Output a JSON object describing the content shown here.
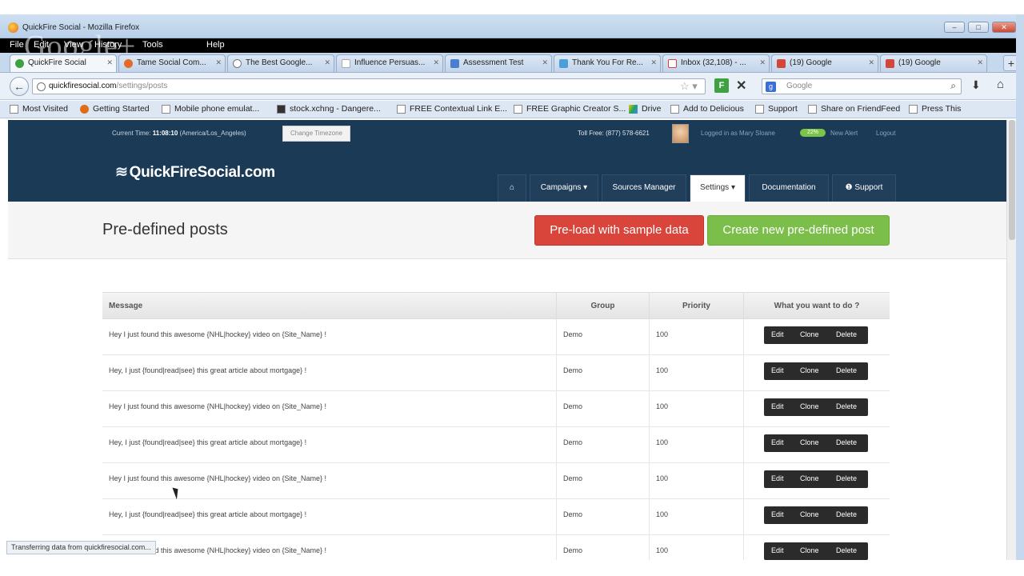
{
  "window": {
    "title": "QuickFire Social - Mozilla Firefox"
  },
  "menubar": {
    "items": [
      "File",
      "Edit",
      "View",
      "History",
      "Tools",
      "Help"
    ],
    "overlay": "Google+"
  },
  "tabs": [
    {
      "label": "QuickFire Social",
      "color": "#3fa142"
    },
    {
      "label": "Tame Social Com...",
      "color": "#e26b2b"
    },
    {
      "label": "The Best Google...",
      "color": "#777777"
    },
    {
      "label": "Influence Persuas...",
      "color": "#bbbbbb"
    },
    {
      "label": "Assessment Test",
      "color": "#4a7fd0"
    },
    {
      "label": "Thank You For Re...",
      "color": "#4a9fd8"
    },
    {
      "label": "Inbox (32,108) - ...",
      "color": "#d4453a"
    },
    {
      "label": "(19) Google",
      "color": "#d4453a"
    },
    {
      "label": "(19) Google",
      "color": "#d4453a"
    }
  ],
  "navbar": {
    "url_host": "quickfiresocial.com",
    "url_path": "/settings/posts",
    "search_placeholder": "Google",
    "f_label": "F",
    "g_label": "g"
  },
  "bookmarks": [
    "Most Visited",
    "Getting Started",
    "Mobile phone emulat...",
    "stock.xchng - Dangere...",
    "FREE Contextual Link E...",
    "FREE Graphic Creator S...",
    "Drive",
    "Add to Delicious",
    "Support",
    "Share on FriendFeed",
    "Press This"
  ],
  "topstrip": {
    "current_time_label": "Current Time:",
    "current_time_value": "11:08:10",
    "timezone": "(America/Los_Angeles)",
    "change_timezone": "Change Timezone",
    "toll_free": "Toll Free: (877) 578-6621",
    "logged_in": "Logged in as Mary Sloane",
    "badge": "22%",
    "new_alert": "New Alert",
    "logout": "Logout"
  },
  "header": {
    "logo": "QuickFireSocial.com",
    "nav": [
      {
        "label": "⌂"
      },
      {
        "label": "Campaigns ▾"
      },
      {
        "label": "Sources Manager"
      },
      {
        "label": "Settings ▾"
      },
      {
        "label": "Documentation"
      },
      {
        "label": "❶ Support"
      }
    ]
  },
  "subheader": {
    "title": "Pre-defined posts",
    "preload_button": "Pre-load with sample data",
    "create_button": "Create new pre-defined post"
  },
  "table": {
    "headers": {
      "message": "Message",
      "group": "Group",
      "priority": "Priority",
      "actions": "What you want to do ?"
    },
    "action_labels": {
      "edit": "Edit",
      "clone": "Clone",
      "delete": "Delete"
    },
    "rows": [
      {
        "message": "Hey I just found this awesome {NHL|hockey} video on {Site_Name} !",
        "group": "Demo",
        "priority": "100"
      },
      {
        "message": "Hey, I just {found|read|see} this great article about mortgage} !",
        "group": "Demo",
        "priority": "100"
      },
      {
        "message": "Hey I just found this awesome {NHL|hockey} video on {Site_Name} !",
        "group": "Demo",
        "priority": "100"
      },
      {
        "message": "Hey, I just {found|read|see} this great article about mortgage} !",
        "group": "Demo",
        "priority": "100"
      },
      {
        "message": "Hey I just found this awesome {NHL|hockey} video on {Site_Name} !",
        "group": "Demo",
        "priority": "100"
      },
      {
        "message": "Hey, I just {found|read|see} this great article about mortgage} !",
        "group": "Demo",
        "priority": "100"
      },
      {
        "message": "Hey I just found this awesome {NHL|hockey} video on {Site_Name} !",
        "group": "Demo",
        "priority": "100"
      }
    ]
  },
  "statusbar": {
    "text": "Transferring data from quickfiresocial.com..."
  },
  "colors": {
    "brand_dark": "#1b3a55",
    "red": "#d9443b",
    "green": "#7bbf4a"
  }
}
